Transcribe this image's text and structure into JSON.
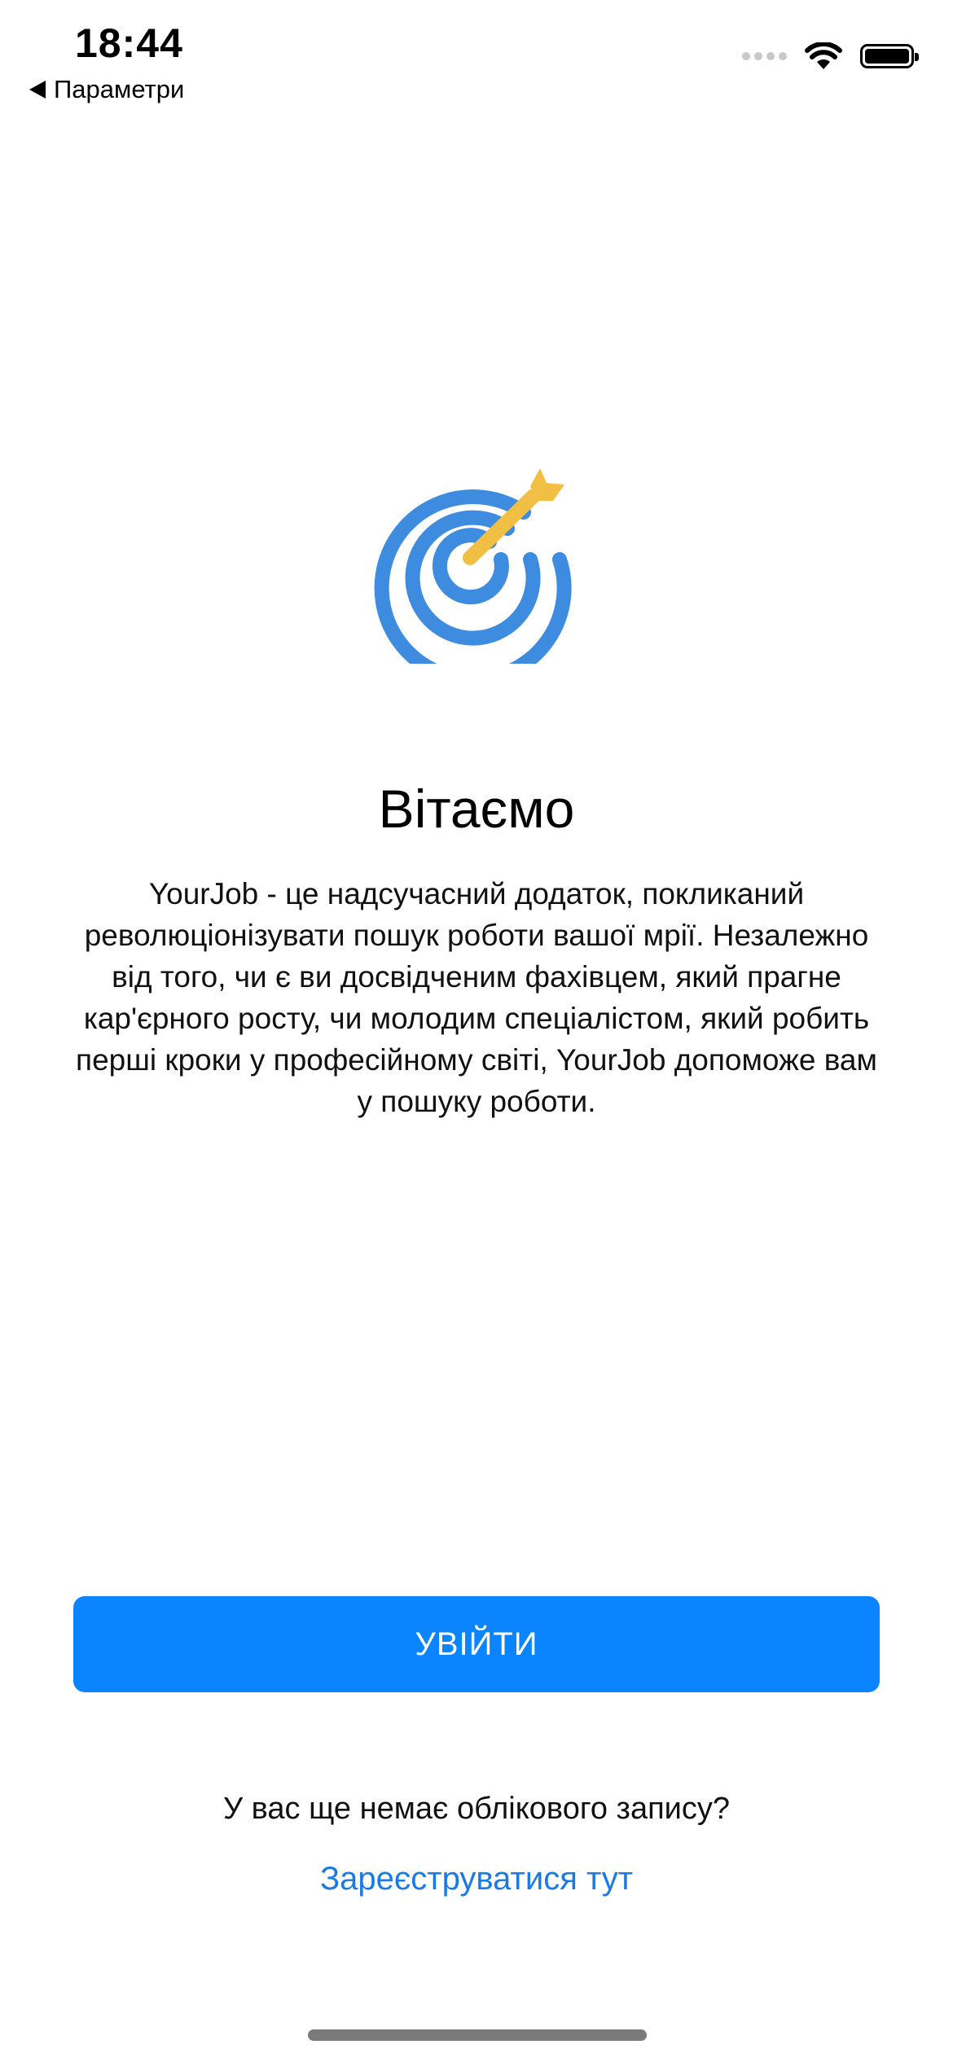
{
  "status_bar": {
    "time": "18:44",
    "back_label": "Параметри"
  },
  "welcome": {
    "title": "Вітаємо",
    "description": "YourJob - це надсучасний додаток, покликаний революціонізувати пошук роботи вашої мрії. Незалежно від того, чи є ви досвідченим фахівцем, який прагне кар'єрного росту, чи молодим спеціалістом, який робить перші кроки у професійному світі, YourJob допоможе вам у пошуку роботи."
  },
  "actions": {
    "login_label": "УВІЙТИ",
    "no_account_text": "У вас ще немає облікового запису?",
    "register_label": "Зареєструватися тут"
  },
  "colors": {
    "accent": "#0a84ff",
    "link": "#1a7ae6",
    "logo_target": "#3d8ce0",
    "logo_arrow": "#f2bf45"
  },
  "icons": {
    "logo": "target-arrow-icon",
    "wifi": "wifi-icon",
    "battery": "battery-icon",
    "signal": "cellular-signal-icon",
    "back": "back-arrow-icon"
  }
}
